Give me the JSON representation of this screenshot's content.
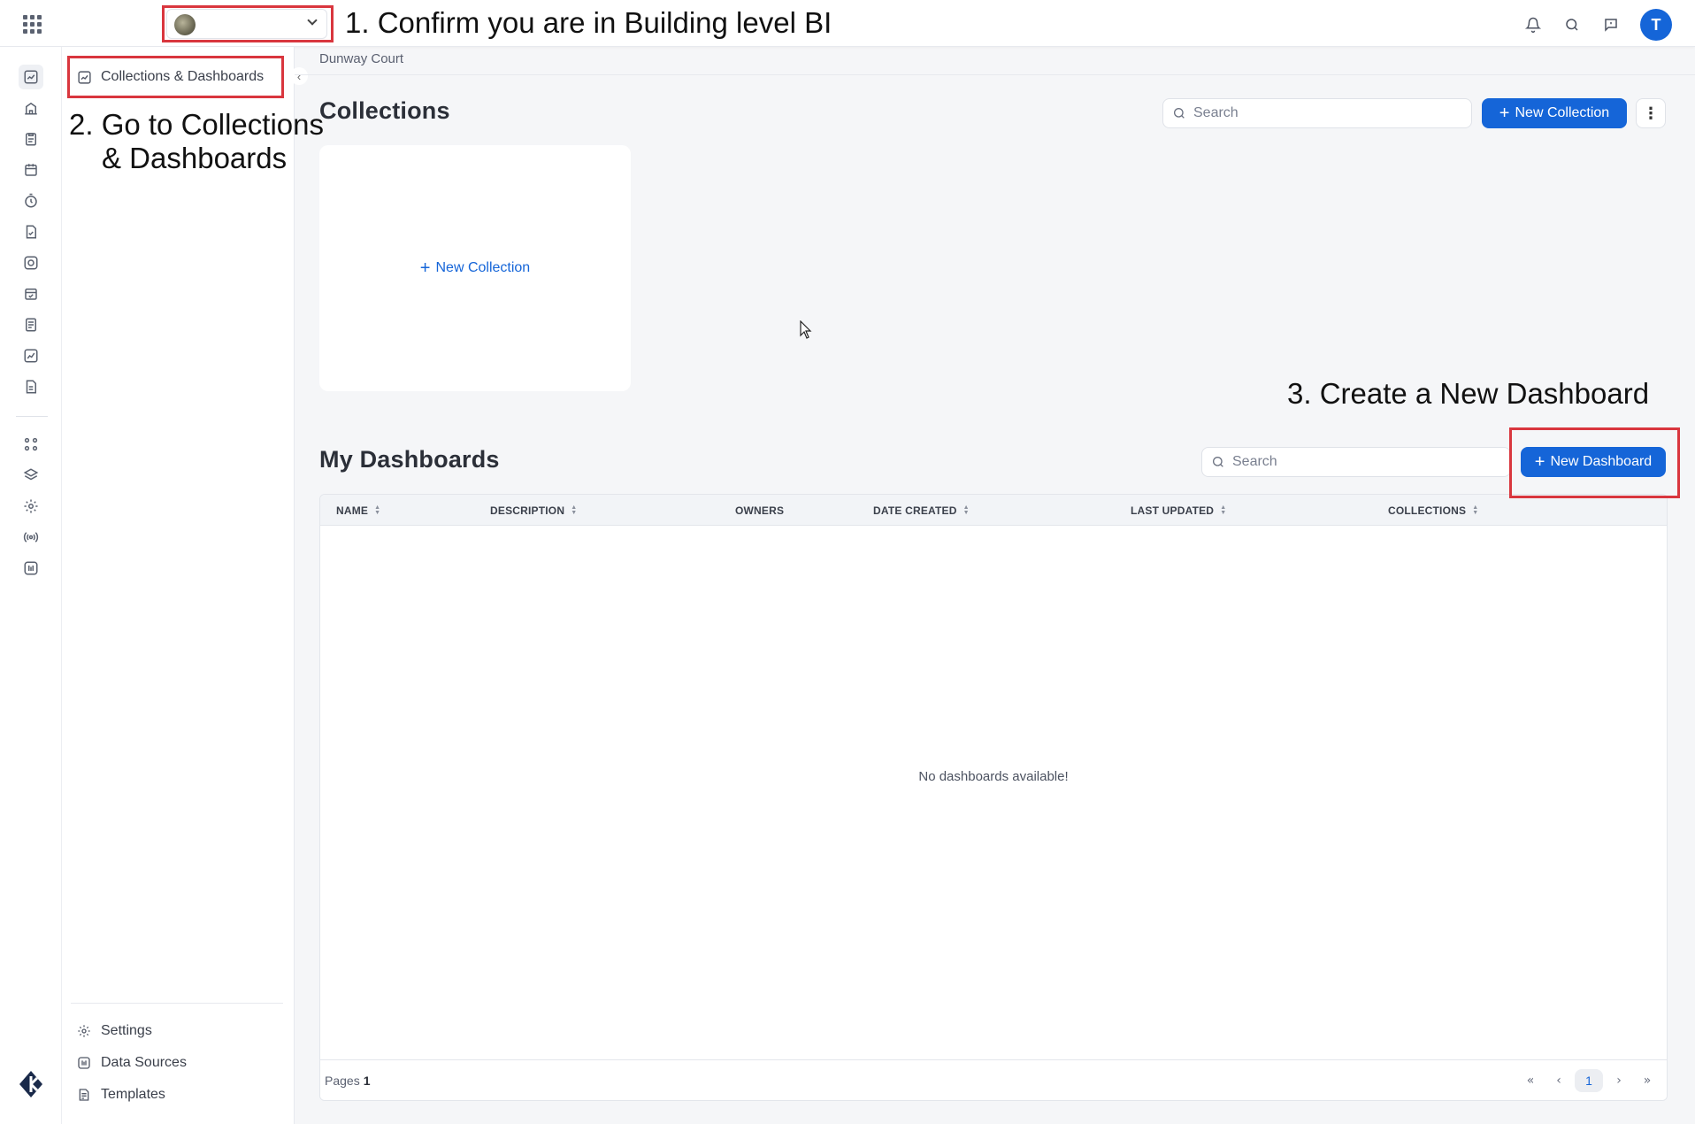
{
  "breadcrumb": "Dunway Court",
  "sidebar": {
    "active_item": "Collections & Dashboards",
    "bottom_items": [
      "Settings",
      "Data Sources",
      "Templates"
    ]
  },
  "collections": {
    "title": "Collections",
    "search_placeholder": "Search",
    "new_button": "New Collection",
    "card_label": "New Collection"
  },
  "dashboards": {
    "title": "My Dashboards",
    "search_placeholder": "Search",
    "new_button": "New Dashboard",
    "columns": [
      "NAME",
      "DESCRIPTION",
      "OWNERS",
      "DATE CREATED",
      "LAST UPDATED",
      "COLLECTIONS"
    ],
    "empty_message": "No dashboards available!",
    "pages_label": "Pages",
    "pages_count": "1",
    "current_page": "1"
  },
  "user": {
    "initial": "T"
  },
  "annotations": {
    "step1": "1. Confirm you are in Building level BI",
    "step2_line1": "2. Go to Collections",
    "step2_line2": "& Dashboards",
    "step3": "3. Create a New Dashboard",
    "color": "#d9363e"
  },
  "colors": {
    "primary": "#1565d8"
  }
}
